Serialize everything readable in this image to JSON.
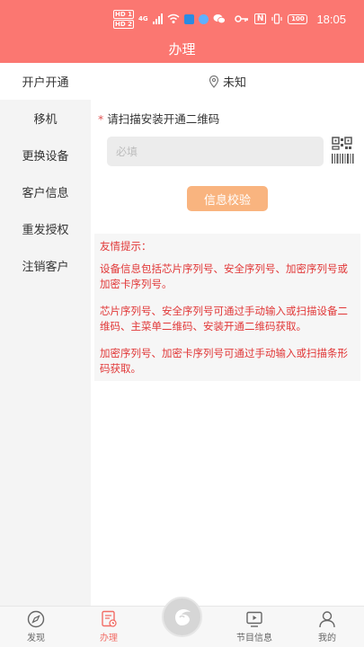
{
  "header": {
    "title": "办理",
    "status": {
      "time": "18:05",
      "battery": "100",
      "net_label": "4G"
    }
  },
  "sidebar": {
    "items": [
      {
        "label": "开户开通",
        "active": true
      },
      {
        "label": "移机",
        "active": false
      },
      {
        "label": "更换设备",
        "active": false
      },
      {
        "label": "客户信息",
        "active": false
      },
      {
        "label": "重发授权",
        "active": false
      },
      {
        "label": "注销客户",
        "active": false
      }
    ]
  },
  "main": {
    "location": "未知",
    "field_label": "请扫描安装开通二维码",
    "required_mark": "*",
    "input": {
      "placeholder": "必填",
      "value": ""
    },
    "verify_button": "信息校验",
    "tips": {
      "title": "友情提示：",
      "lines": [
        "设备信息包括芯片序列号、安全序列号、加密序列号或加密卡序列号。",
        "芯片序列号、安全序列号可通过手动输入或扫描设备二维码、主菜单二维码、安装开通二维码获取。",
        "加密序列号、加密卡序列号可通过手动输入或扫描条形码获取。"
      ]
    }
  },
  "bottom_nav": {
    "items": [
      {
        "label": "发现",
        "icon": "discover-icon",
        "active": false
      },
      {
        "label": "办理",
        "icon": "handle-icon",
        "active": true
      },
      {
        "label": "节目信息",
        "icon": "program-icon",
        "active": false
      },
      {
        "label": "我的",
        "icon": "profile-icon",
        "active": false
      }
    ]
  },
  "colors": {
    "primary": "#fb7771",
    "button": "#f9b47f",
    "tip_text": "#e13838",
    "active_nav": "#f26d66"
  }
}
